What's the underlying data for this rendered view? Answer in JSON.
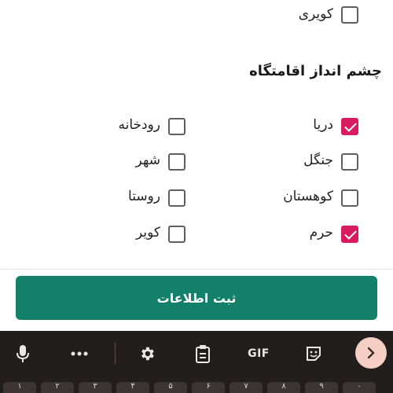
{
  "top_option": {
    "label": "کویری",
    "checked": false
  },
  "section_title": "چشم انداز اقامتگاه",
  "options": [
    {
      "label": "دریا",
      "checked": true
    },
    {
      "label": "رودخانه",
      "checked": false
    },
    {
      "label": "جنگل",
      "checked": false
    },
    {
      "label": "شهر",
      "checked": false
    },
    {
      "label": "کوهستان",
      "checked": false
    },
    {
      "label": "روستا",
      "checked": false
    },
    {
      "label": "حرم",
      "checked": true
    },
    {
      "label": "کویر",
      "checked": false
    }
  ],
  "submit": {
    "label": "ثبت اطلاعات"
  },
  "keyboard": {
    "toolbar": {
      "mic_icon": "microphone-icon",
      "more_icon": "more-dots-icon",
      "settings_icon": "gear-icon",
      "clipboard_icon": "clipboard-icon",
      "gif_label": "GIF",
      "sticker_icon": "sticker-icon",
      "expand_icon": "chevron-right-icon"
    },
    "number_keys": [
      "۱",
      "۲",
      "۳",
      "۴",
      "۵",
      "۶",
      "۷",
      "۸",
      "۹",
      "۰"
    ]
  },
  "colors": {
    "accent_checked": "#d81b60",
    "submit_button": "#138069",
    "keyboard_bg": "#231e1e",
    "expand_button": "#f5cfc4"
  }
}
